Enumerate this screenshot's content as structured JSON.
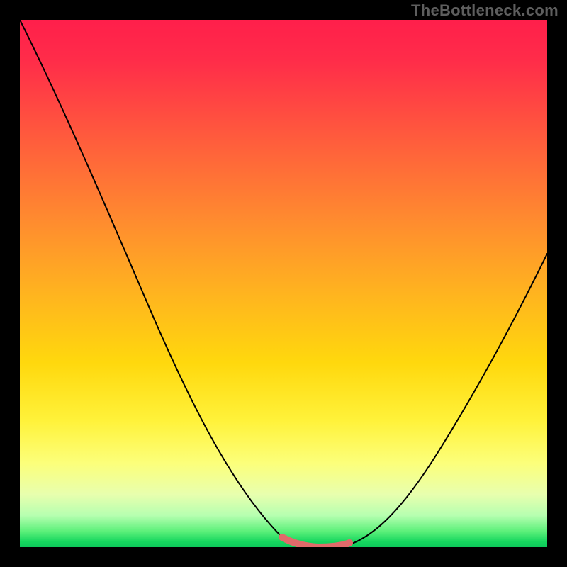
{
  "watermark": "TheBottleneck.com",
  "chart_data": {
    "type": "line",
    "title": "",
    "xlabel": "",
    "ylabel": "",
    "x": [
      0.0,
      0.05,
      0.1,
      0.15,
      0.2,
      0.25,
      0.3,
      0.35,
      0.4,
      0.45,
      0.5,
      0.55,
      0.6,
      0.65,
      0.7,
      0.75,
      0.8,
      0.85,
      0.9,
      0.95,
      1.0
    ],
    "values": [
      1.0,
      0.9,
      0.8,
      0.7,
      0.6,
      0.5,
      0.4,
      0.3,
      0.2,
      0.1,
      0.03,
      0.0,
      0.0,
      0.01,
      0.05,
      0.12,
      0.2,
      0.29,
      0.38,
      0.47,
      0.56
    ],
    "xlim": [
      0,
      1
    ],
    "ylim": [
      0,
      1
    ],
    "annotations": {
      "optimal_range_x": [
        0.5,
        0.62
      ],
      "optimal_range_y": 0.0
    },
    "colors": {
      "curve": "#000000",
      "marker": "#e06a6a",
      "gradient_top": "#ff1f4b",
      "gradient_mid": "#ffd80d",
      "gradient_bottom": "#0ec95b"
    }
  }
}
